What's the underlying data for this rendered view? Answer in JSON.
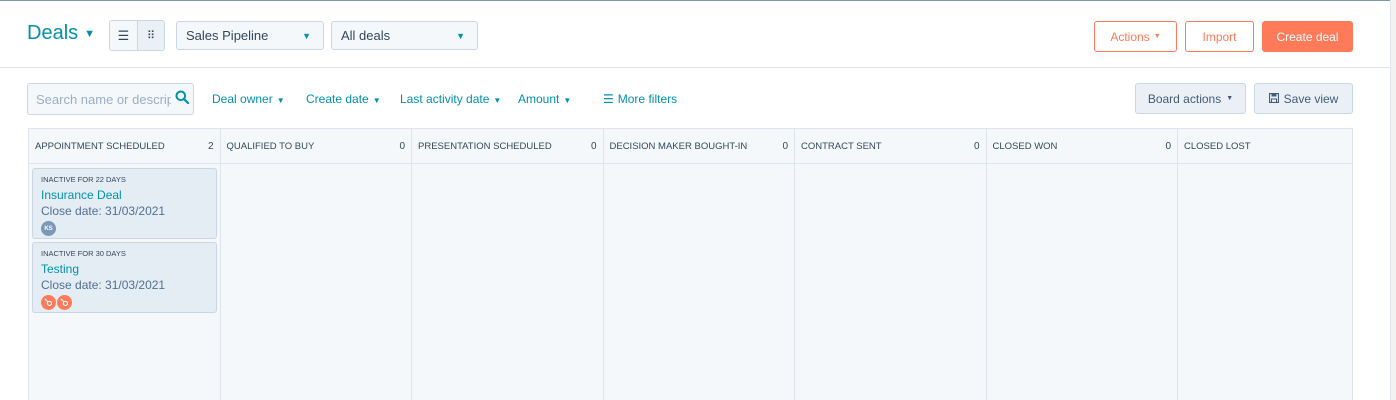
{
  "header": {
    "title": "Deals",
    "pipeline_select": "Sales Pipeline",
    "view_select": "All deals",
    "actions_label": "Actions",
    "import_label": "Import",
    "create_label": "Create deal"
  },
  "filters": {
    "search_placeholder": "Search name or descrip",
    "deal_owner": "Deal owner",
    "create_date": "Create date",
    "last_activity": "Last activity date",
    "amount": "Amount",
    "more_filters": "More filters",
    "board_actions": "Board actions",
    "save_view": "Save view"
  },
  "columns": [
    {
      "name": "APPOINTMENT SCHEDULED",
      "count": "2",
      "cards": [
        {
          "inactive": "INACTIVE FOR 22 DAYS",
          "name": "Insurance Deal",
          "close": "Close date: 31/03/2021",
          "avatars": [
            "KS"
          ]
        },
        {
          "inactive": "INACTIVE FOR 30 DAYS",
          "name": "Testing",
          "close": "Close date: 31/03/2021",
          "avatars": [
            "hubspot",
            "hubspot"
          ]
        }
      ]
    },
    {
      "name": "QUALIFIED TO BUY",
      "count": "0",
      "cards": []
    },
    {
      "name": "PRESENTATION SCHEDULED",
      "count": "0",
      "cards": []
    },
    {
      "name": "DECISION MAKER BOUGHT-IN",
      "count": "0",
      "cards": []
    },
    {
      "name": "CONTRACT SENT",
      "count": "0",
      "cards": []
    },
    {
      "name": "CLOSED WON",
      "count": "0",
      "cards": []
    },
    {
      "name": "CLOSED LOST",
      "count": "",
      "cards": []
    }
  ],
  "colors": {
    "accent": "#0091ae",
    "brand": "#ff7a59",
    "card_bg": "#e5edf4"
  }
}
